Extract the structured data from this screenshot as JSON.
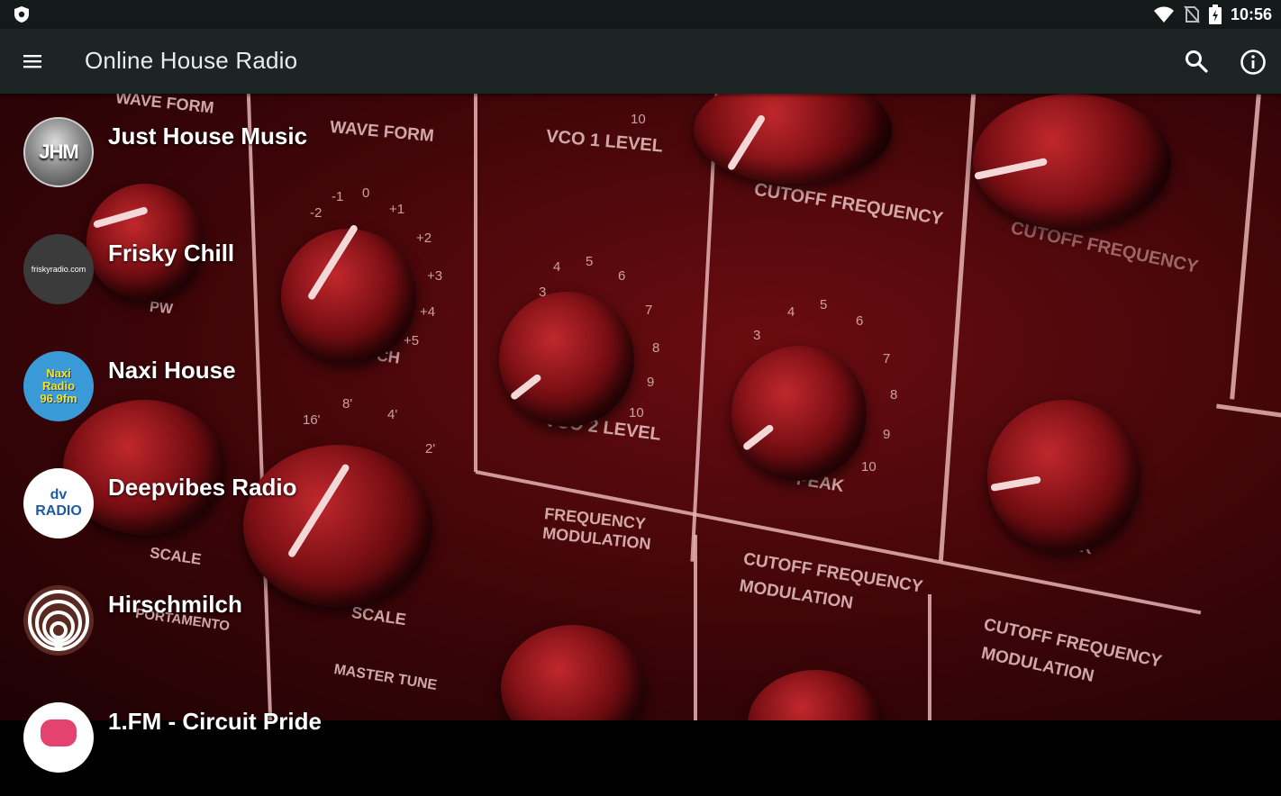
{
  "status_bar": {
    "time": "10:56",
    "icons": [
      "shield-icon",
      "wifi-icon",
      "no-sim-icon",
      "battery-charging-icon"
    ]
  },
  "toolbar": {
    "title": "Online House Radio",
    "menu_icon": "hamburger-menu-icon",
    "search_icon": "search-icon",
    "info_icon": "info-icon"
  },
  "stations": [
    {
      "name": "Just House Music",
      "logo_text": "JHM"
    },
    {
      "name": "Frisky Chill",
      "logo_text": "friskyradio.com"
    },
    {
      "name": "Naxi House",
      "logo_text": "Naxi Radio 96.9fm"
    },
    {
      "name": "Deepvibes Radio",
      "logo_text": "dv RADIO"
    },
    {
      "name": "Hirschmilch",
      "logo_text": ""
    },
    {
      "name": "1.FM - Circuit Pride",
      "logo_text": ""
    }
  ],
  "background_labels": {
    "wave_form_1": "WAVE FORM",
    "wave_form_2": "WAVE FORM",
    "vco1": "VCO 1 LEVEL",
    "vco2": "VCO 2 LEVEL",
    "cutoff1": "CUTOFF FREQUENCY",
    "cutoff2": "CUTOFF FREQUENCY",
    "pitch": "PITCH",
    "peak1": "PEAK",
    "peak2": "PEAK",
    "pw": "PW",
    "scale1": "SCALE",
    "scale2": "SCALE",
    "freq_mod_1": "FREQUENCY",
    "freq_mod_2": "MODULATION",
    "cutoff_mod_1": "CUTOFF FREQUENCY",
    "cutoff_mod_2": "MODULATION",
    "cutoff_mod_3": "CUTOFF FREQUENCY",
    "cutoff_mod_4": "MODULATION",
    "master_tune": "MASTER TUNE",
    "portamento": "PORTAMENTO"
  },
  "colors": {
    "toolbar": "#1c2424",
    "status_bar": "#141a1a",
    "background_red": "#6a0c10"
  }
}
